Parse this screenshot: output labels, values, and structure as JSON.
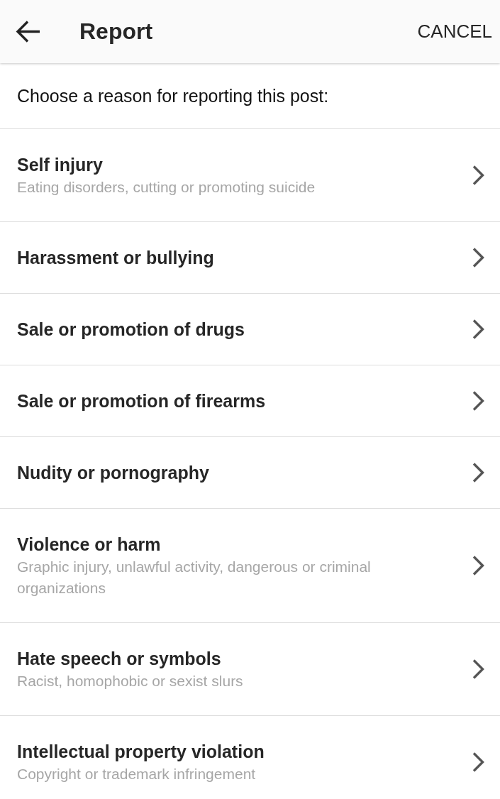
{
  "header": {
    "title": "Report",
    "action": "CANCEL"
  },
  "prompt": "Choose a reason for reporting this post:",
  "reasons": [
    {
      "title": "Self injury",
      "description": "Eating disorders, cutting or promoting suicide"
    },
    {
      "title": "Harassment or bullying"
    },
    {
      "title": "Sale or promotion of drugs"
    },
    {
      "title": "Sale or promotion of firearms"
    },
    {
      "title": "Nudity or pornography"
    },
    {
      "title": "Violence or harm",
      "description": "Graphic injury, unlawful activity, dangerous or criminal organizations"
    },
    {
      "title": "Hate speech or symbols",
      "description": "Racist, homophobic or sexist slurs"
    },
    {
      "title": "Intellectual property violation",
      "description": "Copyright or trademark infringement"
    }
  ]
}
